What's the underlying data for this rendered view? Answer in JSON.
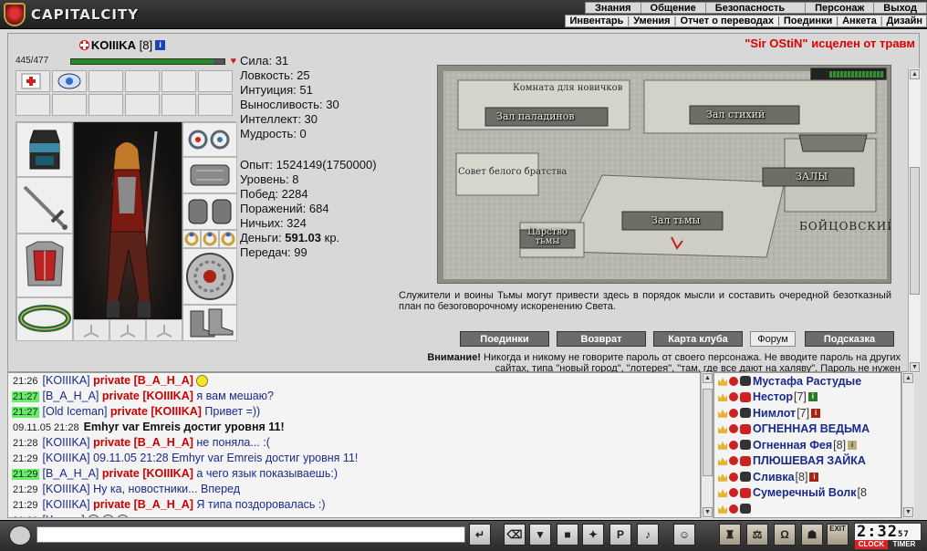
{
  "app": {
    "logo_text": "CAPITALCITY"
  },
  "menu_top": [
    "Знания",
    "Общение",
    "Безопасность",
    "Персонаж",
    "Выход"
  ],
  "menu_sub": [
    "Инвентарь",
    "Умения",
    "Отчет о переводах",
    "Поединки",
    "Анкета",
    "Дизайн"
  ],
  "announcement": "\"Sir OStiN\" исцелен от травм",
  "character": {
    "name": "KOIIIKA",
    "level": "[8]",
    "hp_text": "445/477",
    "hp_fraction": 0.93
  },
  "stats": [
    "Сила: 31",
    "Ловкость: 25",
    "Интуиция: 51",
    "Выносливость: 30",
    "Интеллект: 30",
    "Мудрость: 0"
  ],
  "stats2": {
    "exp": "Опыт: 1524149(1750000)",
    "level": "Уровень: 8",
    "wins": "Побед: 2284",
    "losses": "Поражений: 684",
    "draws": "Ничьих: 324",
    "money_label": "Деньги:",
    "money_value": "591.03",
    "money_unit": "кр.",
    "transfers": "Передач: 99"
  },
  "map": {
    "rooms": {
      "newbie": "Комната для новичков",
      "paladins": "Зал паладинов",
      "elements": "Зал стихий",
      "council": "Совет белого братства",
      "halls": "ЗАЛЫ",
      "darkness_hall": "Зал тьмы",
      "darkness_realm": "Царство тьмы",
      "club": "БОЙЦОВСКИЙ КЛУБ"
    },
    "description": "Служители и воины Тьмы могут привести здесь в порядок мысли и составить очередной безотказный план по безоговорочному искоренению Света."
  },
  "nav_buttons": [
    "Поединки",
    "Возврат",
    "Карта клуба",
    "Форум",
    "Подсказка"
  ],
  "warning": {
    "lead": "Внимание!",
    "text": "Никогда и никому не говорите пароль от своего персонажа. Не вводите пароль на других сайтах, типа \"новый город\", \"лотерея\", \"там, где все дают на халяву\". Пароль не нужен"
  },
  "chat": [
    {
      "time": "21:26",
      "hl": false,
      "from": "KOIIIKA",
      "priv": "private [B_A_H_A]",
      "text": "",
      "smile": true
    },
    {
      "time": "21:27",
      "hl": true,
      "from": "B_A_H_A",
      "priv": "private [KOIIIKA]",
      "text": "я вам мешаю?"
    },
    {
      "time": "21:27",
      "hl": true,
      "from": "Old Iceman",
      "priv": "private [KOIIIKA]",
      "text": "Привет =))"
    },
    {
      "time": "09.11.05 21:28",
      "hl": false,
      "system": "Emhyr var Emreis достиг уровня 11!"
    },
    {
      "time": "21:28",
      "hl": false,
      "from": "KOIIIKA",
      "priv": "private [B_A_H_A]",
      "text": "не поняла... :("
    },
    {
      "time": "21:29",
      "hl": false,
      "from": "KOIIIKA",
      "priv": "",
      "text": "09.11.05 21:28 Emhyr var Emreis достиг уровня 11!"
    },
    {
      "time": "21:29",
      "hl": true,
      "from": "B_A_H_A",
      "priv": "private [KOIIIKA]",
      "text": "а чего язык показываешь:)"
    },
    {
      "time": "21:29",
      "hl": false,
      "from": "KOIIIKA",
      "priv": "",
      "text": "Ну ка, новостники... Вперед"
    },
    {
      "time": "21:29",
      "hl": false,
      "from": "KOIIIKA",
      "priv": "private [B_A_H_A]",
      "text": "Я типа поздоровалась :)"
    },
    {
      "time": "21:29",
      "hl": false,
      "from": "Чешер",
      "priv": "",
      "text": "",
      "smile3": true
    }
  ],
  "online": [
    {
      "name": "Мустафа Растудые",
      "level": ""
    },
    {
      "name": "Нестор",
      "level": "[7]",
      "badge": "green"
    },
    {
      "name": "Нимлот",
      "level": "[7]",
      "badge": "red"
    },
    {
      "name": "ОГНЕННАЯ ВЕДЬМА",
      "level": ""
    },
    {
      "name": "Огненная Фея",
      "level": "[8]",
      "badge": "gray"
    },
    {
      "name": "ПЛЮШЕВАЯ ЗАЙКА",
      "level": ""
    },
    {
      "name": "Сливка",
      "level": "[8]",
      "badge": "red"
    },
    {
      "name": "Сумеречный Волк",
      "level": "[8"
    },
    {
      "name": "",
      "level": ""
    }
  ],
  "clock": {
    "time": "2:32",
    "sec": "57",
    "label_clock": "CLOCK",
    "label_timer": "TIMER"
  },
  "toolbar": {
    "exit_label": "EXIT",
    "chat_placeholder": ""
  }
}
